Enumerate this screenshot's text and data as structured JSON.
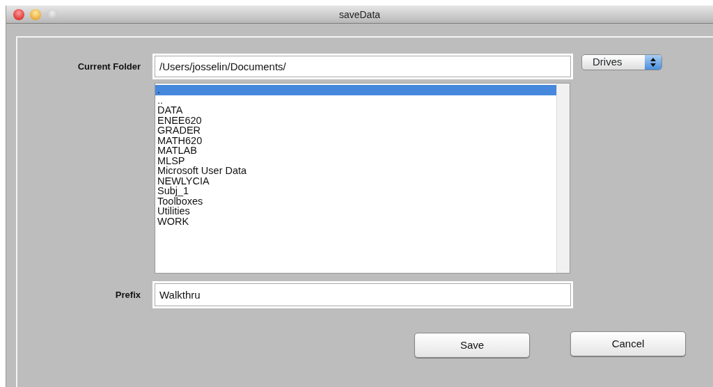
{
  "window": {
    "title": "saveData"
  },
  "current_folder": {
    "label": "Current Folder",
    "value": "/Users/josselin/Documents/"
  },
  "drives": {
    "value": "Drives"
  },
  "folder_list": [
    {
      "name": ".",
      "selected": true
    },
    {
      "name": "..",
      "selected": false
    },
    {
      "name": "DATA",
      "selected": false
    },
    {
      "name": "ENEE620",
      "selected": false
    },
    {
      "name": "GRADER",
      "selected": false
    },
    {
      "name": "MATH620",
      "selected": false
    },
    {
      "name": "MATLAB",
      "selected": false
    },
    {
      "name": "MLSP",
      "selected": false
    },
    {
      "name": "Microsoft User Data",
      "selected": false
    },
    {
      "name": "NEWLYCIA",
      "selected": false
    },
    {
      "name": "Subj_1",
      "selected": false
    },
    {
      "name": "Toolboxes",
      "selected": false
    },
    {
      "name": "Utilities",
      "selected": false
    },
    {
      "name": "WORK",
      "selected": false
    }
  ],
  "prefix": {
    "label": "Prefix",
    "value": "Walkthru"
  },
  "buttons": [
    {
      "label": "Save"
    },
    {
      "label": "Cancel"
    }
  ]
}
